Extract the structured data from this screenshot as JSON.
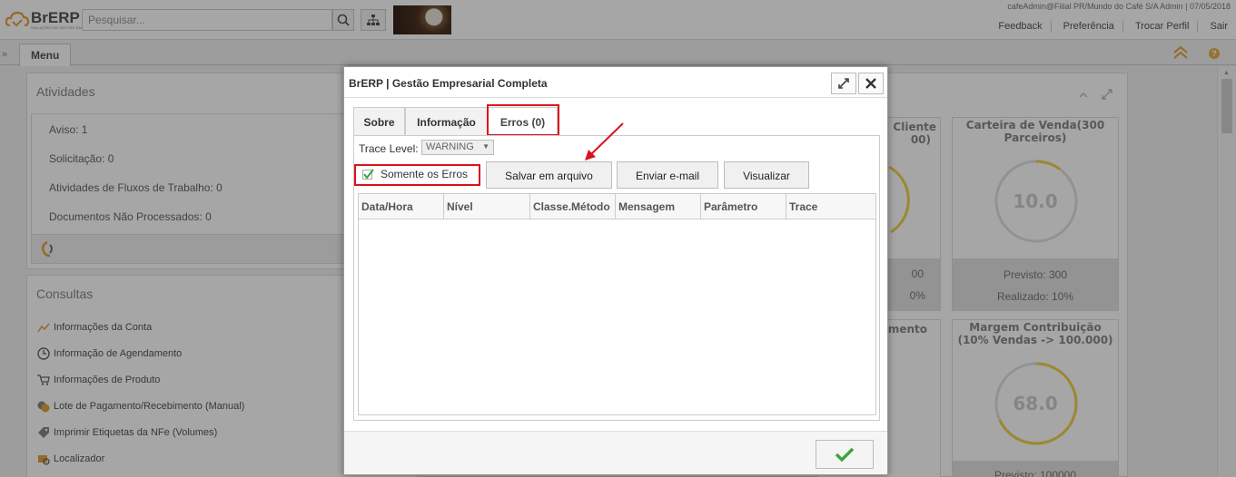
{
  "header": {
    "logo_text": "BrERP",
    "logo_tagline": "SOLUÇÕES DE GESTÃO EMPRESARIAL",
    "search_placeholder": "Pesquisar...",
    "user_info": "cafeAdmin@Filial PR/Mundo do Café S/A Admin | 07/05/2018",
    "links": [
      "Feedback",
      "Preferência",
      "Trocar Perfil",
      "Sair"
    ]
  },
  "tabbar": {
    "menu_tab": "Menu",
    "help_label": "?"
  },
  "dashboard": {
    "atividades": {
      "title": "Atividades",
      "items": [
        "Aviso: 1",
        "Solicitação: 0",
        "Atividades de Fluxos de Trabalho: 0",
        "Documentos Não Processados: 0"
      ]
    },
    "consultas": {
      "title": "Consultas",
      "items": [
        {
          "label": "Informações da Conta",
          "icon": "chart-line-icon"
        },
        {
          "label": "Informação de Agendamento",
          "icon": "clock-icon"
        },
        {
          "label": "Informações de Produto",
          "icon": "cart-icon"
        },
        {
          "label": "Lote de Pagamento/Recebimento (Manual)",
          "icon": "coins-icon"
        },
        {
          "label": "Imprimir Etiquetas da NFe (Volumes)",
          "icon": "tag-icon"
        },
        {
          "label": "Localizador",
          "icon": "folder-search-icon"
        }
      ]
    },
    "kpis": [
      {
        "title": "Carteira de Venda(300 Parceiros)",
        "value": "10.0",
        "previsto": "Previsto: 300",
        "realizado": "Realizado: 10%",
        "progress": 0.1
      },
      {
        "title": "Margem Contribuição (10% Vendas -> 100.000)",
        "value": "68.0",
        "previsto": "Previsto: 100000",
        "progress": 0.68
      }
    ],
    "partial_kpis": {
      "top_title_1": "Cliente",
      "top_title_2": "00)",
      "top_line_1": "00",
      "top_line_2": "0%",
      "bottom_title": "amento"
    }
  },
  "dialog": {
    "title": "BrERP | Gestão Empresarial Completa",
    "tabs": [
      "Sobre",
      "Informação",
      "Erros (0)"
    ],
    "active_tab": "Erros (0)",
    "trace_level_label": "Trace Level:",
    "trace_level_value": "WARNING",
    "only_errors_label": "Somente os Erros",
    "only_errors_checked": true,
    "buttons": {
      "save": "Salvar em arquivo",
      "email": "Enviar e-mail",
      "view": "Visualizar"
    },
    "grid_columns": [
      "Data/Hora",
      "Nível",
      "Classe.Método",
      "Mensagem",
      "Parâmetro",
      "Trace"
    ],
    "rows": []
  },
  "colors": {
    "brand": "#e8a040",
    "annotation_red": "#d9141b",
    "gauge_yellow": "#f0d24a",
    "ok_green": "#3ca53c"
  }
}
